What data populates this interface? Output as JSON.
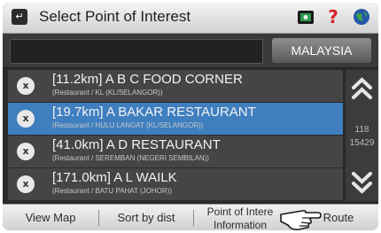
{
  "header": {
    "title": "Select Point of Interest",
    "back_icon": "back-arrow-icon"
  },
  "search": {
    "value": "",
    "country": "MALAYSIA"
  },
  "poi_list": [
    {
      "distance": "[11.2km]",
      "name": "A B C FOOD CORNER",
      "details": "(Restaurant / KL (KL/SELANGOR))",
      "icon": "restaurant-icon",
      "selected": false
    },
    {
      "distance": "[19.7km]",
      "name": "A BAKAR RESTAURANT",
      "details": "(Restaurant / HULU LANGAT (KL/SELANGOR))",
      "icon": "restaurant-icon",
      "selected": true
    },
    {
      "distance": "[41.0km]",
      "name": "A D RESTAURANT",
      "details": "(Restaurant / SEREMBAN (NEGERI SEMBILAN))",
      "icon": "restaurant-icon",
      "selected": false
    },
    {
      "distance": "[171.0km]",
      "name": "A L WAILK",
      "details": "(Restaurant / BATU PAHAT (JOHOR))",
      "icon": "restaurant-icon",
      "selected": false
    }
  ],
  "pagination": {
    "current": "118",
    "total": "15429"
  },
  "bottom_tabs": {
    "view_map": "View Map",
    "sort": "Sort by dist",
    "poi_line1": "Point of Intere",
    "poi_line2": "Information",
    "route": "Route"
  },
  "colors": {
    "selected_row": "#3f7fbf",
    "row_bg": "#444546",
    "help_red": "#d8222a"
  }
}
